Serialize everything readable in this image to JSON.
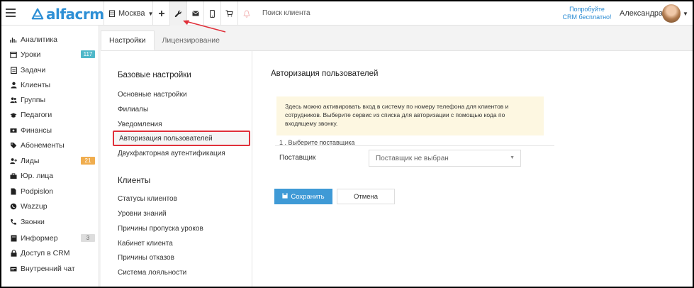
{
  "header": {
    "logo_text": "alfacrm",
    "branch": "Москва",
    "search_placeholder": "Поиск клиента",
    "promo_line1": "Попробуйте",
    "promo_line2": "CRM бесплатно!",
    "user_name": "Александра",
    "icons": [
      "menu-icon",
      "plus-icon",
      "wrench-icon",
      "mail-icon",
      "phone-icon",
      "cart-icon",
      "bell-icon"
    ]
  },
  "sidebar": {
    "items": [
      {
        "label": "Аналитика",
        "icon": "chart-icon"
      },
      {
        "label": "Уроки",
        "icon": "calendar-icon",
        "badge": "117"
      },
      {
        "label": "Задачи",
        "icon": "tasks-icon"
      },
      {
        "label": "Клиенты",
        "icon": "user-icon"
      },
      {
        "label": "Группы",
        "icon": "users-icon"
      },
      {
        "label": "Педагоги",
        "icon": "graduation-cap-icon"
      },
      {
        "label": "Финансы",
        "icon": "money-icon"
      },
      {
        "label": "Абонементы",
        "icon": "tag-icon"
      },
      {
        "label": "Лиды",
        "icon": "user-plus-icon",
        "badge": "21"
      },
      {
        "label": "Юр. лица",
        "icon": "briefcase-icon"
      },
      {
        "label": "Podpislon",
        "icon": "document-icon"
      },
      {
        "label": "Wazzup",
        "icon": "whatsapp-icon"
      },
      {
        "label": "Звонки",
        "icon": "phone-icon"
      },
      {
        "label": "Информер",
        "icon": "book-icon",
        "badge": "3"
      },
      {
        "label": "Доступ в CRM",
        "icon": "lock-icon"
      },
      {
        "label": "Внутренний чат",
        "icon": "chat-icon"
      }
    ]
  },
  "tabs": [
    {
      "label": "Настройки",
      "active": true
    },
    {
      "label": "Лицензирование",
      "active": false
    }
  ],
  "settings_nav": {
    "section1_title": "Базовые настройки",
    "section1_items": [
      "Основные настройки",
      "Филиалы",
      "Уведомления",
      "Авторизация пользователей",
      "Двухфакторная аутентификация"
    ],
    "section2_title": "Клиенты",
    "section2_items": [
      "Статусы клиентов",
      "Уровни знаний",
      "Причины пропуска уроков",
      "Кабинет клиента",
      "Причины отказов",
      "Система лояльности"
    ]
  },
  "main": {
    "title": "Авторизация пользователей",
    "notice": "Здесь можно активировать вход в систему по номеру телефона для клиентов и сотрудников. Выберите сервис из списка для авторизации с помощью кода по входящему звонку.",
    "step": "1 . Выберите поставщика",
    "provider_label": "Поставщик",
    "provider_value": "Поставщик не выбран",
    "save_label": "Сохранить",
    "cancel_label": "Отмена"
  },
  "colors": {
    "accent": "#3f9ad6",
    "brand": "#2d8fd5",
    "highlight_border": "#e0303a",
    "notice_bg": "#fdf7e1",
    "badge_teal": "#4fb8c9",
    "badge_orange": "#f0ad4e"
  }
}
